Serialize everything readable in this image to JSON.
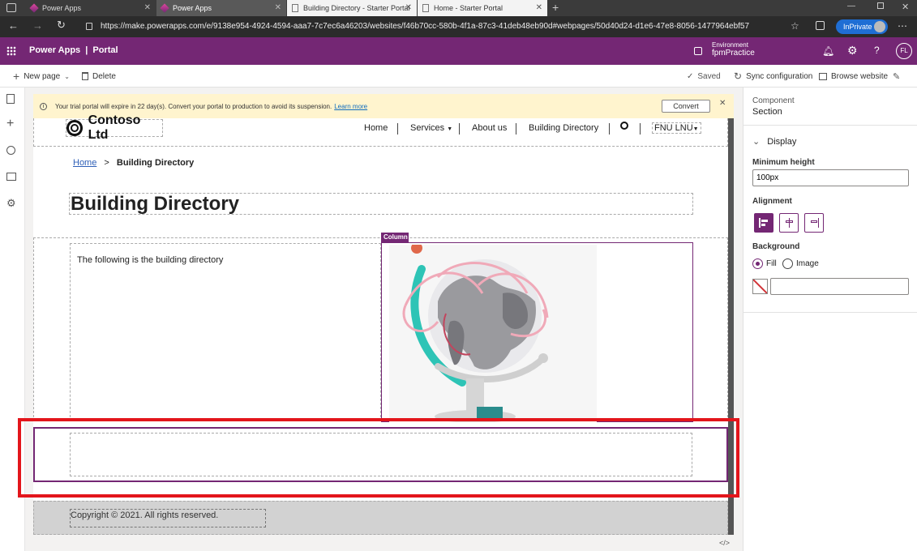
{
  "browser": {
    "tabs": [
      {
        "label": "Power Apps"
      },
      {
        "label": "Power Apps"
      },
      {
        "label": "Building Directory - Starter Portal"
      },
      {
        "label": "Home - Starter Portal"
      }
    ],
    "url": "https://make.powerapps.com/e/9138e954-4924-4594-aaa7-7c7ec6a46203/websites/f46b70cc-580b-4f1a-87c3-41deb48eb90d#webpages/50d40d24-d1e6-47e8-8056-1477964ebf57",
    "inprivate_label": "InPrivate"
  },
  "app": {
    "title": "Power Apps",
    "section": "Portal",
    "environment_label": "Environment",
    "environment_name": "fpmPractice",
    "user_initials": "FL"
  },
  "toolbar": {
    "new_page": "New page",
    "delete": "Delete",
    "saved": "Saved",
    "sync": "Sync configuration",
    "browse": "Browse website"
  },
  "trial_banner": {
    "text": "Your trial portal will expire in 22 day(s). Convert your portal to production to avoid its suspension.",
    "link": "Learn more",
    "button": "Convert"
  },
  "site": {
    "brand": "Contoso Ltd",
    "nav": [
      "Home",
      "Services",
      "About us",
      "Building Directory"
    ],
    "user_menu": "FNU LNU",
    "breadcrumb_home": "Home",
    "breadcrumb_sep": ">",
    "breadcrumb_current": "Building Directory",
    "page_title": "Building Directory",
    "body_text": "The following is the building directory",
    "column_tag": "Column",
    "footer": "Copyright © 2021. All rights reserved."
  },
  "panel": {
    "component_label": "Component",
    "component_value": "Section",
    "display_heading": "Display",
    "min_height_label": "Minimum height",
    "min_height_value": "100px",
    "alignment_label": "Alignment",
    "background_label": "Background",
    "fill_option": "Fill",
    "image_option": "Image",
    "color_value": ""
  },
  "colors": {
    "brand_purple": "#742774",
    "highlight_red": "#e3151b",
    "trial_bg": "#fff4ce"
  },
  "bottom": {
    "code_icon": "</>"
  }
}
